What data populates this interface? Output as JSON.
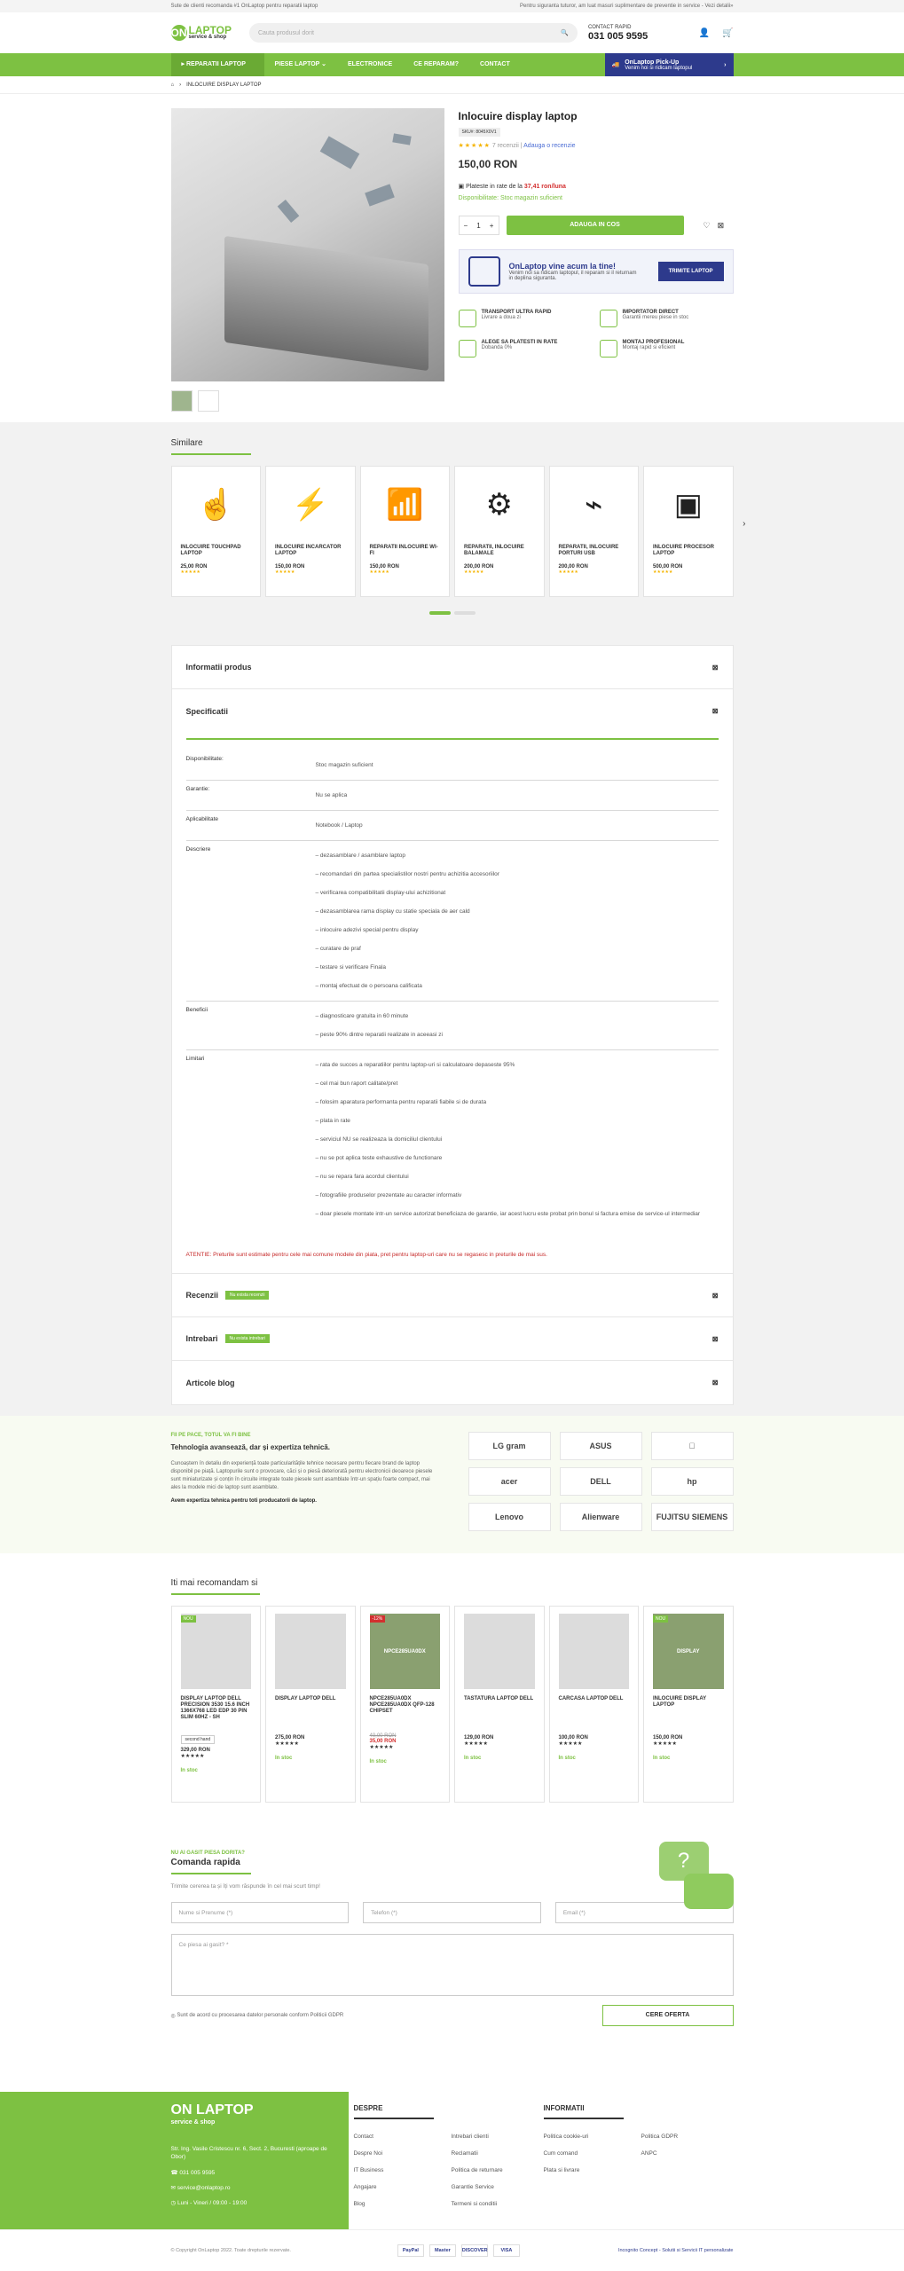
{
  "topbar": {
    "left": "Sute de clienti recomanda #1 OnLaptop pentru reparatii laptop",
    "right": "Pentru siguranta tuturor, am luat masuri suplimentare de preventie in service - Vezi detalii»"
  },
  "header": {
    "logo": "ON",
    "logo_name": "LAPTOP",
    "logo_sub": "service & shop",
    "search_placeholder": "Cauta produsul dorit",
    "contact_label": "CONTACT RAPID",
    "phone": "031 005 9595",
    "user_icon": "user-icon",
    "cart_icon": "cart-icon"
  },
  "nav": {
    "items": [
      "REPARATII LAPTOP",
      "PIESE LAPTOP",
      "ELECTRONICE",
      "CE REPARAM?",
      "CONTACT"
    ],
    "pickup_title": "OnLaptop Pick-Up",
    "pickup_sub": "Venim noi si ridicam laptopul"
  },
  "breadcrumb": {
    "current": "INLOCUIRE DISPLAY LAPTOP"
  },
  "product": {
    "title": "Inlocuire display laptop",
    "sku": "SKU#: 8045X0V1",
    "stars": "★★★★★",
    "reviews": "7 recenzii",
    "add_review": "Adauga o recenzie",
    "price": "150,00 RON",
    "rate_label": "Plateste in rate de la",
    "rate_value": "37,41 ron/luna",
    "availability": "Disponibilitate: Stoc magazin suficient",
    "qty": "1",
    "add_to_cart": "ADAUGA IN COS",
    "promo": {
      "title": "OnLaptop vine acum la tine!",
      "text": "Venim noi sa ridicam laptopul, il reparam si il returnam in deplina siguranta.",
      "button": "TRIMITE LAPTOP"
    },
    "benefits": [
      {
        "title": "TRANSPORT ULTRA RAPID",
        "sub": "Livrare a doua zi"
      },
      {
        "title": "IMPORTATOR DIRECT",
        "sub": "Garantii mereu piese in stoc"
      },
      {
        "title": "ALEGE SA PLATESTI IN RATE",
        "sub": "Dobanda 0%"
      },
      {
        "title": "MONTAJ PROFESIONAL",
        "sub": "Montaj rapid si eficient"
      }
    ]
  },
  "similar": {
    "title": "Similare",
    "items": [
      {
        "name": "INLOCUIRE TOUCHPAD LAPTOP",
        "price": "25,00 RON",
        "icon": "touchpad-icon",
        "glyph": "☝"
      },
      {
        "name": "INLOCUIRE INCARCATOR LAPTOP",
        "price": "150,00 RON",
        "icon": "charger-icon",
        "glyph": "⚡"
      },
      {
        "name": "REPARATII INLOCUIRE WI-FI",
        "price": "150,00 RON",
        "icon": "wifi-icon",
        "glyph": "📶"
      },
      {
        "name": "REPARATII, INLOCUIRE BALAMALE",
        "price": "200,00 RON",
        "icon": "hinge-icon",
        "glyph": "⚙"
      },
      {
        "name": "REPARATII, INLOCUIRE PORTURI USB",
        "price": "200,00 RON",
        "icon": "usb-icon",
        "glyph": "⌁"
      },
      {
        "name": "INLOCUIRE PROCESOR LAPTOP",
        "price": "500,00 RON",
        "icon": "cpu-icon",
        "glyph": "▣"
      }
    ]
  },
  "tabs": {
    "info": "Informatii produs",
    "specs": "Specificatii",
    "reviews": "Recenzii",
    "reviews_badge": "Nu exista recenzii",
    "questions": "Intrebari",
    "questions_badge": "Nu exista intrebari",
    "blog": "Articole blog"
  },
  "specs": [
    {
      "k": "Disponibilitate:",
      "v": [
        "Stoc magazin suficient"
      ]
    },
    {
      "k": "Garantie:",
      "v": [
        "Nu se aplica"
      ]
    },
    {
      "k": "Aplicabilitate",
      "v": [
        "Notebook / Laptop"
      ]
    },
    {
      "k": "Descriere",
      "v": [
        "– dezasamblare / asamblare laptop",
        "– recomandari din partea specialistilor nostri pentru achizitia accesoriilor",
        "– verificarea compatibilitatii display-ului achizitionat",
        "– dezasamblarea rama display cu statie speciala de aer cald",
        "– inlocuire adezivi special pentru display",
        "– curatare de praf",
        "– testare si verificare Finala",
        "– montaj efectuat de o persoana calificata"
      ]
    },
    {
      "k": "Beneficii",
      "v": [
        "– diagnosticare gratuita in 60 minute",
        "– peste 90% dintre reparatii realizate in aceeasi zi"
      ]
    },
    {
      "k": "Limitari",
      "v": [
        "– rata de succes a reparatiilor pentru laptop-uri si calculatoare depaseste 95%",
        "– cel mai bun raport calitate/pret",
        "– folosim aparatura performanta pentru reparatii fiabile si de durata",
        "– plata in rate",
        "– serviciul NU se realizeaza la domiciliul clientului",
        "– nu se pot aplica teste exhaustive de functionare",
        "– nu se repara fara acordul clientului",
        "– fotografiile produselor prezentate au caracter informativ",
        "– doar piesele montate intr-un service autorizat beneficiaza de garantie, iar acest lucru este probat prin bonul si factura emise de service-ul intermediar"
      ]
    }
  ],
  "warning": "ATENTIE: Preturile sunt estimate pentru cele mai comune modele din piata, pret pentru laptop-uri care nu se regasesc in preturile de mai sus.",
  "brands": {
    "eyebrow": "FII PE PACE, TOTUL VA FI BINE",
    "title": "Tehnologia avansează, dar și expertiza tehnică.",
    "text": "Cunoaștem în detaliu din experiență toate particularitățile tehnice necesare pentru fiecare brand de laptop disponibil pe piață. Laptopurile sunt o provocare, căci și o piesă deteriorată pentru electronicii deoarece piesele sunt miniaturizate și conțin în circuite integrate toate piesele sunt asamblate într-un spațiu foarte compact, mai ales la modele mici de laptop sunt asamblate.",
    "bold": "Avem expertiza tehnica pentru toti producatorii de laptop.",
    "logos": [
      "LG gram",
      "ASUS",
      "",
      "acer",
      "DELL",
      "hp",
      "Lenovo",
      "Alienware",
      "FUJITSU SIEMENS"
    ]
  },
  "recs": {
    "title": "Iti mai recomandam si",
    "items": [
      {
        "tag": "NOU",
        "name": "DISPLAY LAPTOP DELL PRECISION 3530 15.6 INCH 1366X768 LED EDP 30 PIN SLIM 60HZ - SH",
        "label": "second hand",
        "price": "329,00 RON",
        "stock": "In stoc"
      },
      {
        "tag": "",
        "name": "DISPLAY LAPTOP DELL",
        "label": "",
        "price": "275,00 RON",
        "stock": "In stoc"
      },
      {
        "tag": "-12%",
        "name": "NPCE285UA0DX NPCE285UA0DX QFP-128 CHIPSET",
        "label": "",
        "old": "40,00 RON",
        "price": "35,00 RON",
        "stock": "In stoc",
        "img": "NPCE285UA0DX"
      },
      {
        "tag": "",
        "name": "TASTATURA LAPTOP DELL",
        "label": "",
        "price": "129,00 RON",
        "stock": "In stoc"
      },
      {
        "tag": "",
        "name": "CARCASA LAPTOP DELL",
        "label": "",
        "price": "100,00 RON",
        "stock": "In stoc"
      },
      {
        "tag": "NOU",
        "name": "INLOCUIRE DISPLAY LAPTOP",
        "label": "",
        "price": "150,00 RON",
        "stock": "In stoc",
        "img": "DISPLAY"
      }
    ]
  },
  "quick": {
    "eyebrow": "NU AI GASIT PIESA DORITA?",
    "title": "Comanda rapida",
    "text": "Trimite cererea ta și îți vom răspunde în cel mai scurt timp!",
    "name": "Nume si Prenume (*)",
    "phone": "Telefon (*)",
    "email": "Email (*)",
    "message": "Ce piesa ai gasit? *",
    "gdpr": "Sunt de acord cu procesarea datelor personale conform Politicii GDPR",
    "submit": "CERE OFERTA"
  },
  "footer": {
    "address": "Str. Ing. Vasile Cristescu nr. 6, Sect. 2, Bucuresti (aproape de Obor)",
    "phone": "031 005 9595",
    "email": "service@onlaptop.ro",
    "hours": "Luni - Vineri / 09:00 - 19:00",
    "about_title": "DESPRE",
    "about": [
      "Contact",
      "Despre Noi",
      "IT Business",
      "Angajare",
      "Blog"
    ],
    "about2": [
      "Intrebari clienti",
      "Reclamatii",
      "Politica de returnare",
      "Garantie Service",
      "Termeni si conditii"
    ],
    "info_title": "INFORMATII",
    "info": [
      "Politica cookie-uri",
      "Cum comand",
      "Plata si livrare"
    ],
    "info2": [
      "Politica GDPR",
      "ANPC"
    ]
  },
  "copyright": "© Copyright OnLaptop 2022. Toate drepturile rezervate.",
  "payments": [
    "PayPal",
    "Master",
    "DISCOVER",
    "VISA"
  ],
  "credit": "Incognito Concept - Solutii si Servicii IT personalizate"
}
